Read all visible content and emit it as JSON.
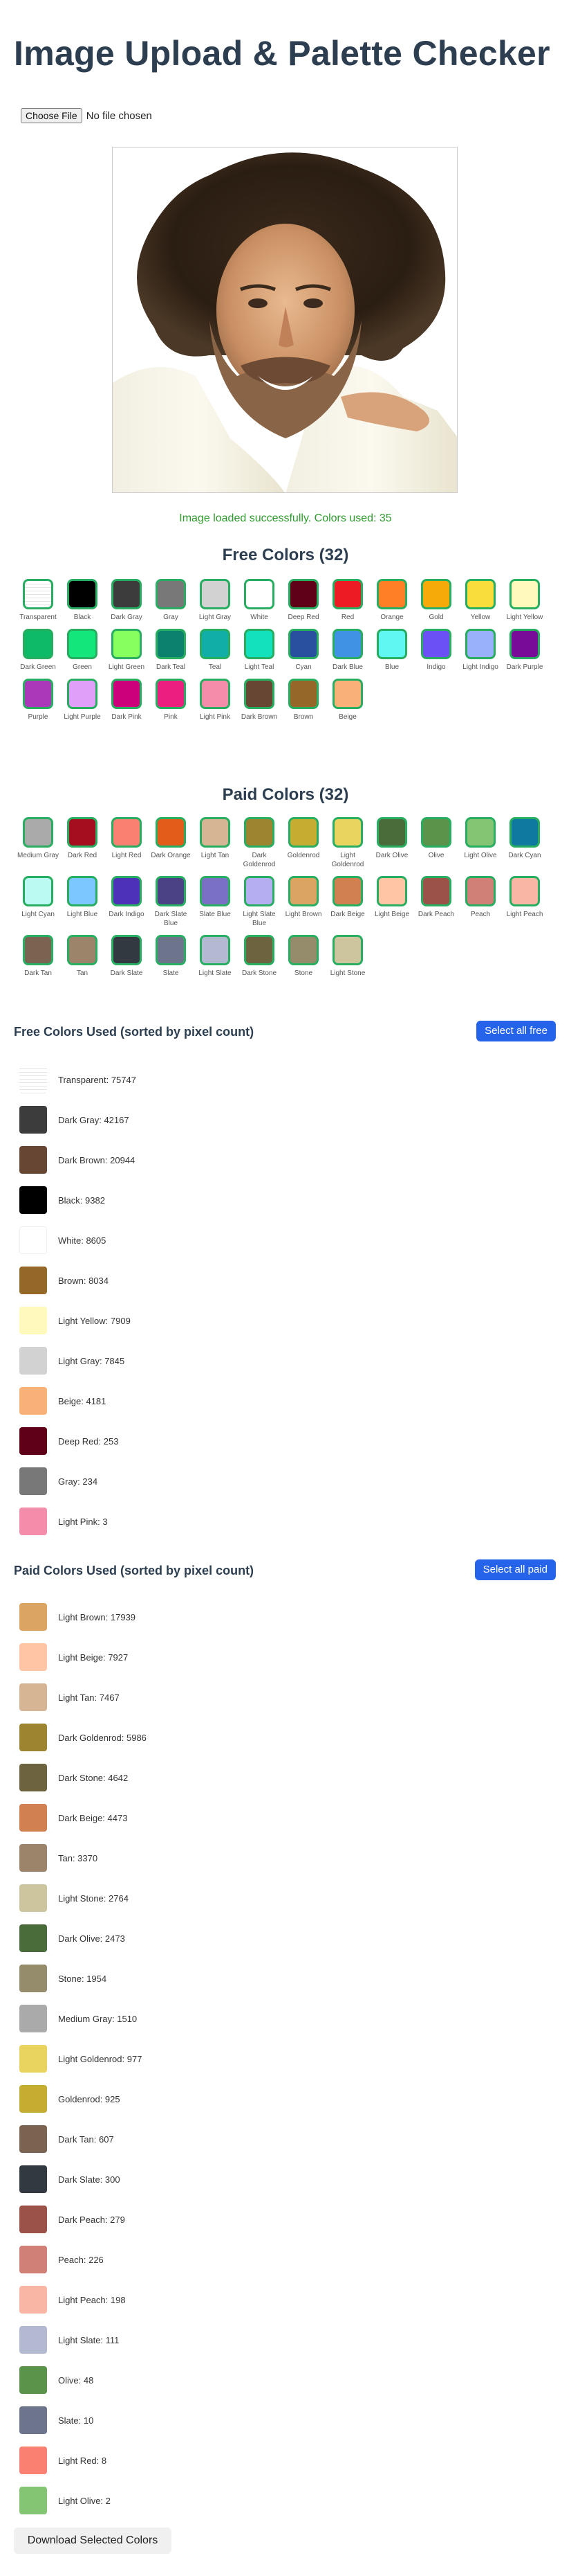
{
  "title": "Image Upload & Palette Checker",
  "file_input": {
    "button": "Choose File",
    "status": "No file chosen"
  },
  "status_message": "Image loaded successfully. Colors used: 35",
  "free_title": "Free Colors (32)",
  "paid_title": "Paid Colors (32)",
  "free_colors": [
    {
      "name": "Transparent",
      "hex": "transparent"
    },
    {
      "name": "Black",
      "hex": "#000000"
    },
    {
      "name": "Dark Gray",
      "hex": "#3c3c3c"
    },
    {
      "name": "Gray",
      "hex": "#787878"
    },
    {
      "name": "Light Gray",
      "hex": "#d2d2d2"
    },
    {
      "name": "White",
      "hex": "#ffffff"
    },
    {
      "name": "Deep Red",
      "hex": "#600018"
    },
    {
      "name": "Red",
      "hex": "#ed1c24"
    },
    {
      "name": "Orange",
      "hex": "#ff7f27"
    },
    {
      "name": "Gold",
      "hex": "#f6aa09"
    },
    {
      "name": "Yellow",
      "hex": "#f9dd3b"
    },
    {
      "name": "Light Yellow",
      "hex": "#fffabc"
    },
    {
      "name": "Dark Green",
      "hex": "#0eb968"
    },
    {
      "name": "Green",
      "hex": "#13e67b"
    },
    {
      "name": "Light Green",
      "hex": "#87ff5e"
    },
    {
      "name": "Dark Teal",
      "hex": "#0c816e"
    },
    {
      "name": "Teal",
      "hex": "#10aea6"
    },
    {
      "name": "Light Teal",
      "hex": "#13e1be"
    },
    {
      "name": "Cyan",
      "hex": "#28509e"
    },
    {
      "name": "Dark Blue",
      "hex": "#4093e4"
    },
    {
      "name": "Blue",
      "hex": "#60f7f2"
    },
    {
      "name": "Indigo",
      "hex": "#6b50f6"
    },
    {
      "name": "Light Indigo",
      "hex": "#99b1fb"
    },
    {
      "name": "Dark Purple",
      "hex": "#780c99"
    },
    {
      "name": "Purple",
      "hex": "#aa38b9"
    },
    {
      "name": "Light Purple",
      "hex": "#e09ff9"
    },
    {
      "name": "Dark Pink",
      "hex": "#cb007a"
    },
    {
      "name": "Pink",
      "hex": "#ec1f80"
    },
    {
      "name": "Light Pink",
      "hex": "#f38da9"
    },
    {
      "name": "Dark Brown",
      "hex": "#684634"
    },
    {
      "name": "Brown",
      "hex": "#95682a"
    },
    {
      "name": "Beige",
      "hex": "#f8b277"
    }
  ],
  "paid_colors": [
    {
      "name": "Medium Gray",
      "hex": "#aaaaaa"
    },
    {
      "name": "Dark Red",
      "hex": "#a50e1e"
    },
    {
      "name": "Light Red",
      "hex": "#fa8072"
    },
    {
      "name": "Dark Orange",
      "hex": "#e45c1a"
    },
    {
      "name": "Light Tan",
      "hex": "#d6b594"
    },
    {
      "name": "Dark Goldenrod",
      "hex": "#9c8431"
    },
    {
      "name": "Goldenrod",
      "hex": "#c5ad31"
    },
    {
      "name": "Light Goldenrod",
      "hex": "#e8d45f"
    },
    {
      "name": "Dark Olive",
      "hex": "#4a6b3a"
    },
    {
      "name": "Olive",
      "hex": "#5a944a"
    },
    {
      "name": "Light Olive",
      "hex": "#84c573"
    },
    {
      "name": "Dark Cyan",
      "hex": "#0f799f"
    },
    {
      "name": "Light Cyan",
      "hex": "#bbfaf2"
    },
    {
      "name": "Light Blue",
      "hex": "#7dc7ff"
    },
    {
      "name": "Dark Indigo",
      "hex": "#4d31b8"
    },
    {
      "name": "Dark Slate Blue",
      "hex": "#4a4284"
    },
    {
      "name": "Slate Blue",
      "hex": "#7a71c4"
    },
    {
      "name": "Light Slate Blue",
      "hex": "#b5aef1"
    },
    {
      "name": "Light Brown",
      "hex": "#dba463"
    },
    {
      "name": "Dark Beige",
      "hex": "#d18051"
    },
    {
      "name": "Light Beige",
      "hex": "#ffc5a5"
    },
    {
      "name": "Dark Peach",
      "hex": "#9b5249"
    },
    {
      "name": "Peach",
      "hex": "#d18078"
    },
    {
      "name": "Light Peach",
      "hex": "#fab6a4"
    },
    {
      "name": "Dark Tan",
      "hex": "#7b6352"
    },
    {
      "name": "Tan",
      "hex": "#9c846b"
    },
    {
      "name": "Dark Slate",
      "hex": "#333941"
    },
    {
      "name": "Slate",
      "hex": "#6d758d"
    },
    {
      "name": "Light Slate",
      "hex": "#b3b9d1"
    },
    {
      "name": "Dark Stone",
      "hex": "#6d643f"
    },
    {
      "name": "Stone",
      "hex": "#948c6b"
    },
    {
      "name": "Light Stone",
      "hex": "#cdc59e"
    }
  ],
  "free_used_title": "Free Colors Used (sorted by pixel count)",
  "select_all_free": "Select all free",
  "free_used": [
    {
      "label": "Transparent: 75747",
      "hex": "transparent"
    },
    {
      "label": "Dark Gray: 42167",
      "hex": "#3c3c3c"
    },
    {
      "label": "Dark Brown: 20944",
      "hex": "#684634"
    },
    {
      "label": "Black: 9382",
      "hex": "#000000"
    },
    {
      "label": "White: 8605",
      "hex": "#ffffff"
    },
    {
      "label": "Brown: 8034",
      "hex": "#95682a"
    },
    {
      "label": "Light Yellow: 7909",
      "hex": "#fffabc"
    },
    {
      "label": "Light Gray: 7845",
      "hex": "#d2d2d2"
    },
    {
      "label": "Beige: 4181",
      "hex": "#f8b277"
    },
    {
      "label": "Deep Red: 253",
      "hex": "#600018"
    },
    {
      "label": "Gray: 234",
      "hex": "#787878"
    },
    {
      "label": "Light Pink: 3",
      "hex": "#f38da9"
    }
  ],
  "paid_used_title": "Paid Colors Used (sorted by pixel count)",
  "select_all_paid": "Select all paid",
  "paid_used": [
    {
      "label": "Light Brown: 17939",
      "hex": "#dba463"
    },
    {
      "label": "Light Beige: 7927",
      "hex": "#ffc5a5"
    },
    {
      "label": "Light Tan: 7467",
      "hex": "#d6b594"
    },
    {
      "label": "Dark Goldenrod: 5986",
      "hex": "#9c8431"
    },
    {
      "label": "Dark Stone: 4642",
      "hex": "#6d643f"
    },
    {
      "label": "Dark Beige: 4473",
      "hex": "#d18051"
    },
    {
      "label": "Tan: 3370",
      "hex": "#9c846b"
    },
    {
      "label": "Light Stone: 2764",
      "hex": "#cdc59e"
    },
    {
      "label": "Dark Olive: 2473",
      "hex": "#4a6b3a"
    },
    {
      "label": "Stone: 1954",
      "hex": "#948c6b"
    },
    {
      "label": "Medium Gray: 1510",
      "hex": "#aaaaaa"
    },
    {
      "label": "Light Goldenrod: 977",
      "hex": "#e8d45f"
    },
    {
      "label": "Goldenrod: 925",
      "hex": "#c5ad31"
    },
    {
      "label": "Dark Tan: 607",
      "hex": "#7b6352"
    },
    {
      "label": "Dark Slate: 300",
      "hex": "#333941"
    },
    {
      "label": "Dark Peach: 279",
      "hex": "#9b5249"
    },
    {
      "label": "Peach: 226",
      "hex": "#d18078"
    },
    {
      "label": "Light Peach: 198",
      "hex": "#fab6a4"
    },
    {
      "label": "Light Slate: 111",
      "hex": "#b3b9d1"
    },
    {
      "label": "Olive: 48",
      "hex": "#5a944a"
    },
    {
      "label": "Slate: 10",
      "hex": "#6d758d"
    },
    {
      "label": "Light Red: 8",
      "hex": "#fa8072"
    },
    {
      "label": "Light Olive: 2",
      "hex": "#84c573"
    }
  ],
  "download_label": "Download Selected Colors"
}
